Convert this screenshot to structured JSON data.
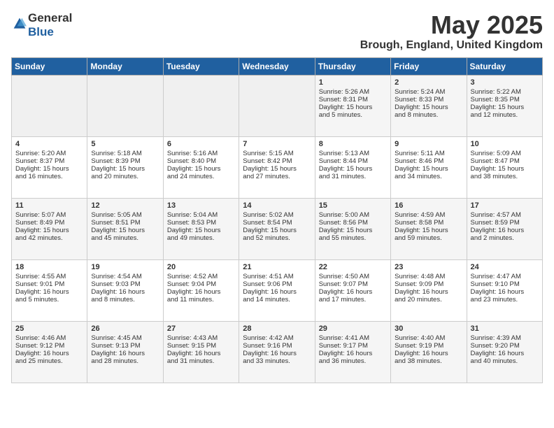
{
  "header": {
    "logo_general": "General",
    "logo_blue": "Blue",
    "title": "May 2025",
    "subtitle": "Brough, England, United Kingdom"
  },
  "days_of_week": [
    "Sunday",
    "Monday",
    "Tuesday",
    "Wednesday",
    "Thursday",
    "Friday",
    "Saturday"
  ],
  "weeks": [
    [
      {
        "day": "",
        "content": ""
      },
      {
        "day": "",
        "content": ""
      },
      {
        "day": "",
        "content": ""
      },
      {
        "day": "",
        "content": ""
      },
      {
        "day": "1",
        "content": "Sunrise: 5:26 AM\nSunset: 8:31 PM\nDaylight: 15 hours\nand 5 minutes."
      },
      {
        "day": "2",
        "content": "Sunrise: 5:24 AM\nSunset: 8:33 PM\nDaylight: 15 hours\nand 8 minutes."
      },
      {
        "day": "3",
        "content": "Sunrise: 5:22 AM\nSunset: 8:35 PM\nDaylight: 15 hours\nand 12 minutes."
      }
    ],
    [
      {
        "day": "4",
        "content": "Sunrise: 5:20 AM\nSunset: 8:37 PM\nDaylight: 15 hours\nand 16 minutes."
      },
      {
        "day": "5",
        "content": "Sunrise: 5:18 AM\nSunset: 8:39 PM\nDaylight: 15 hours\nand 20 minutes."
      },
      {
        "day": "6",
        "content": "Sunrise: 5:16 AM\nSunset: 8:40 PM\nDaylight: 15 hours\nand 24 minutes."
      },
      {
        "day": "7",
        "content": "Sunrise: 5:15 AM\nSunset: 8:42 PM\nDaylight: 15 hours\nand 27 minutes."
      },
      {
        "day": "8",
        "content": "Sunrise: 5:13 AM\nSunset: 8:44 PM\nDaylight: 15 hours\nand 31 minutes."
      },
      {
        "day": "9",
        "content": "Sunrise: 5:11 AM\nSunset: 8:46 PM\nDaylight: 15 hours\nand 34 minutes."
      },
      {
        "day": "10",
        "content": "Sunrise: 5:09 AM\nSunset: 8:47 PM\nDaylight: 15 hours\nand 38 minutes."
      }
    ],
    [
      {
        "day": "11",
        "content": "Sunrise: 5:07 AM\nSunset: 8:49 PM\nDaylight: 15 hours\nand 42 minutes."
      },
      {
        "day": "12",
        "content": "Sunrise: 5:05 AM\nSunset: 8:51 PM\nDaylight: 15 hours\nand 45 minutes."
      },
      {
        "day": "13",
        "content": "Sunrise: 5:04 AM\nSunset: 8:53 PM\nDaylight: 15 hours\nand 49 minutes."
      },
      {
        "day": "14",
        "content": "Sunrise: 5:02 AM\nSunset: 8:54 PM\nDaylight: 15 hours\nand 52 minutes."
      },
      {
        "day": "15",
        "content": "Sunrise: 5:00 AM\nSunset: 8:56 PM\nDaylight: 15 hours\nand 55 minutes."
      },
      {
        "day": "16",
        "content": "Sunrise: 4:59 AM\nSunset: 8:58 PM\nDaylight: 15 hours\nand 59 minutes."
      },
      {
        "day": "17",
        "content": "Sunrise: 4:57 AM\nSunset: 8:59 PM\nDaylight: 16 hours\nand 2 minutes."
      }
    ],
    [
      {
        "day": "18",
        "content": "Sunrise: 4:55 AM\nSunset: 9:01 PM\nDaylight: 16 hours\nand 5 minutes."
      },
      {
        "day": "19",
        "content": "Sunrise: 4:54 AM\nSunset: 9:03 PM\nDaylight: 16 hours\nand 8 minutes."
      },
      {
        "day": "20",
        "content": "Sunrise: 4:52 AM\nSunset: 9:04 PM\nDaylight: 16 hours\nand 11 minutes."
      },
      {
        "day": "21",
        "content": "Sunrise: 4:51 AM\nSunset: 9:06 PM\nDaylight: 16 hours\nand 14 minutes."
      },
      {
        "day": "22",
        "content": "Sunrise: 4:50 AM\nSunset: 9:07 PM\nDaylight: 16 hours\nand 17 minutes."
      },
      {
        "day": "23",
        "content": "Sunrise: 4:48 AM\nSunset: 9:09 PM\nDaylight: 16 hours\nand 20 minutes."
      },
      {
        "day": "24",
        "content": "Sunrise: 4:47 AM\nSunset: 9:10 PM\nDaylight: 16 hours\nand 23 minutes."
      }
    ],
    [
      {
        "day": "25",
        "content": "Sunrise: 4:46 AM\nSunset: 9:12 PM\nDaylight: 16 hours\nand 25 minutes."
      },
      {
        "day": "26",
        "content": "Sunrise: 4:45 AM\nSunset: 9:13 PM\nDaylight: 16 hours\nand 28 minutes."
      },
      {
        "day": "27",
        "content": "Sunrise: 4:43 AM\nSunset: 9:15 PM\nDaylight: 16 hours\nand 31 minutes."
      },
      {
        "day": "28",
        "content": "Sunrise: 4:42 AM\nSunset: 9:16 PM\nDaylight: 16 hours\nand 33 minutes."
      },
      {
        "day": "29",
        "content": "Sunrise: 4:41 AM\nSunset: 9:17 PM\nDaylight: 16 hours\nand 36 minutes."
      },
      {
        "day": "30",
        "content": "Sunrise: 4:40 AM\nSunset: 9:19 PM\nDaylight: 16 hours\nand 38 minutes."
      },
      {
        "day": "31",
        "content": "Sunrise: 4:39 AM\nSunset: 9:20 PM\nDaylight: 16 hours\nand 40 minutes."
      }
    ]
  ]
}
